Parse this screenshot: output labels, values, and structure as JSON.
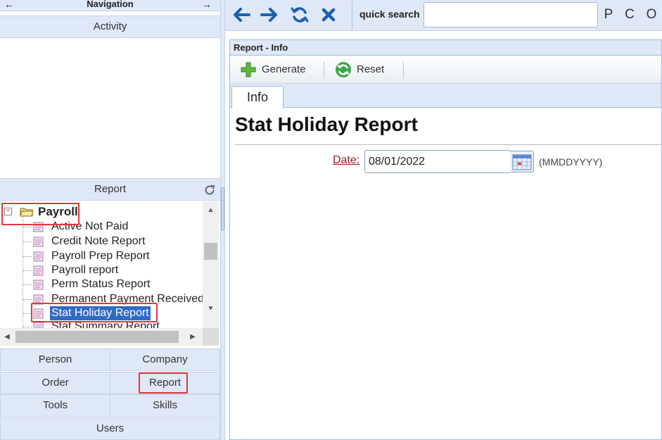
{
  "nav": {
    "title": "Navigation",
    "left_arrow": "←",
    "right_arrow": "→",
    "activity_label": "Activity",
    "report_section_label": "Report",
    "tree": {
      "root_label": "Payroll",
      "items": [
        {
          "label": "Active Not Paid"
        },
        {
          "label": "Credit Note Report"
        },
        {
          "label": "Payroll Prep Report"
        },
        {
          "label": "Payroll report"
        },
        {
          "label": "Perm Status Report"
        },
        {
          "label": "Permanent Payment Received"
        },
        {
          "label": "Stat Holiday Report"
        },
        {
          "label": "Stat Summary Report"
        }
      ],
      "selected_index": 6
    },
    "buttons": {
      "person": "Person",
      "company": "Company",
      "order": "Order",
      "report": "Report",
      "tools": "Tools",
      "skills": "Skills",
      "users": "Users"
    }
  },
  "topbar": {
    "quick_search_label": "quick search",
    "quick_search_value": "",
    "search_buttons": [
      "P",
      "C",
      "O"
    ]
  },
  "panel": {
    "title": "Report - Info",
    "toolbar": {
      "generate_label": "Generate",
      "reset_label": "Reset"
    },
    "tabs": [
      {
        "label": "Info"
      }
    ],
    "report_title": "Stat Holiday Report",
    "date_label": "Date:",
    "date_value": "08/01/2022",
    "date_format_hint": "(MMDDYYYY)"
  },
  "colors": {
    "nav_bg": "#dfe8f6",
    "highlight_red": "#e0383e",
    "selection_blue": "#3169c6",
    "toolbar_icon_blue": "#1a5fb4",
    "date_label_red": "#8b1e1e"
  }
}
